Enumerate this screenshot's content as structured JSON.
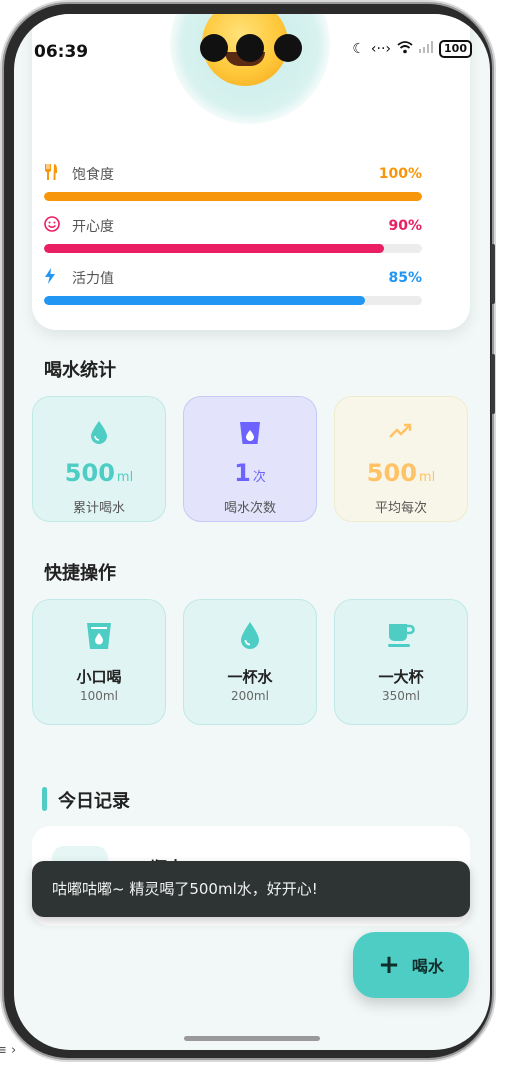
{
  "status_bar": {
    "time": "06:39",
    "icons": [
      "moon-icon",
      "data-arrows-icon",
      "wifi-icon",
      "signal-icon"
    ],
    "battery": "100"
  },
  "pet_stats": [
    {
      "icon": "fork-knife-icon",
      "glyph": "🍴",
      "label": "饱食度",
      "value": "100%",
      "fraction": 1.0,
      "color": "#f7960a"
    },
    {
      "icon": "smile-icon",
      "glyph": "☺",
      "label": "开心度",
      "value": "90%",
      "fraction": 0.9,
      "color": "#e91e63"
    },
    {
      "icon": "bolt-icon",
      "glyph": "ϟ",
      "label": "活力值",
      "value": "85%",
      "fraction": 0.85,
      "color": "#2196f3"
    }
  ],
  "drink_stats": {
    "title": "喝水统计",
    "tiles": [
      {
        "icon": "water-drop-icon",
        "value": "500",
        "unit": "ml",
        "label": "累计喝水",
        "accent": "#4ecdc4"
      },
      {
        "icon": "cup-icon",
        "value": "1",
        "unit": "次",
        "label": "喝水次数",
        "accent": "#6c63ff"
      },
      {
        "icon": "trend-up-icon",
        "value": "500",
        "unit": "ml",
        "label": "平均每次",
        "accent": "#ffc266"
      }
    ]
  },
  "quick_actions": {
    "title": "快捷操作",
    "items": [
      {
        "icon": "cup-icon",
        "name": "小口喝",
        "amount": "100ml"
      },
      {
        "icon": "water-drop-icon",
        "name": "一杯水",
        "amount": "200ml"
      },
      {
        "icon": "coffee-icon",
        "name": "一大杯",
        "amount": "350ml"
      }
    ]
  },
  "records": {
    "title": "今日记录",
    "first_item": "瓶水"
  },
  "toast": "咕嘟咕嘟~ 精灵喝了500ml水，好开心!",
  "fab_label": "喝水",
  "outside_text": "≡ ›"
}
